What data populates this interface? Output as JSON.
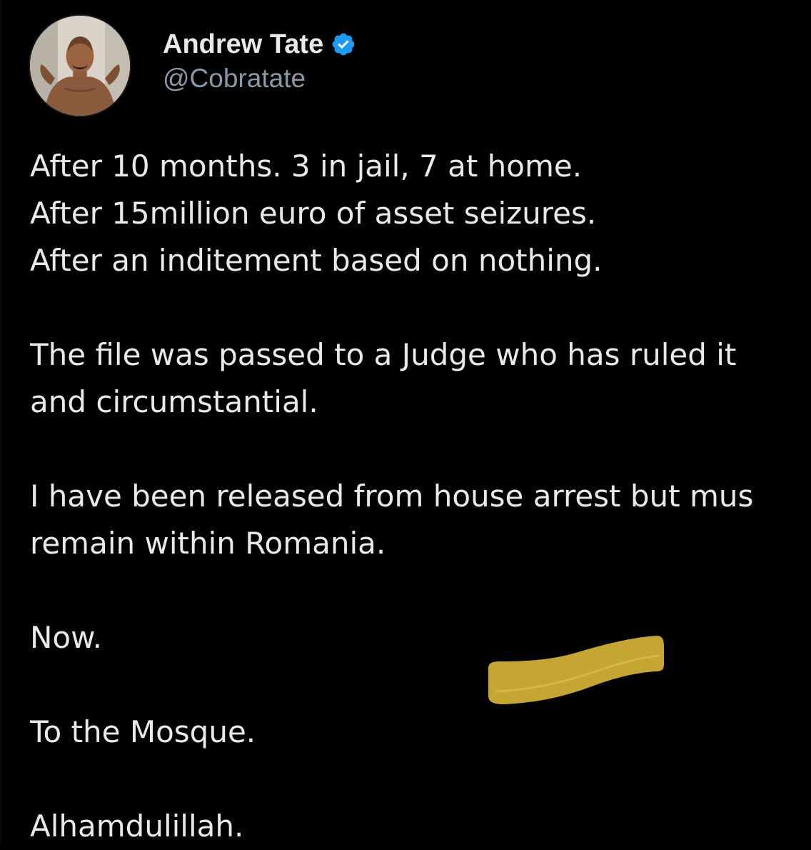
{
  "author": {
    "display_name": "Andrew Tate",
    "handle": "@Cobratate",
    "verified_icon": "verified-badge-icon",
    "badge_color": "#1d9bf0"
  },
  "tweet": {
    "lines": [
      "After 10 months. 3 in jail, 7 at home.",
      "After 15million euro of asset seizures.",
      "After an inditement based on nothing.",
      "The file was passed to a Judge who has ruled it",
      "and circumstantial.",
      "I have been released from house arrest but mus",
      "remain within Romania.",
      "Now.",
      "To the Mosque.",
      "Alhamdulillah."
    ]
  },
  "colors": {
    "background": "#000000",
    "text": "#e7e9ea",
    "handle": "#8b98a5",
    "marker": "#d6b43a"
  }
}
